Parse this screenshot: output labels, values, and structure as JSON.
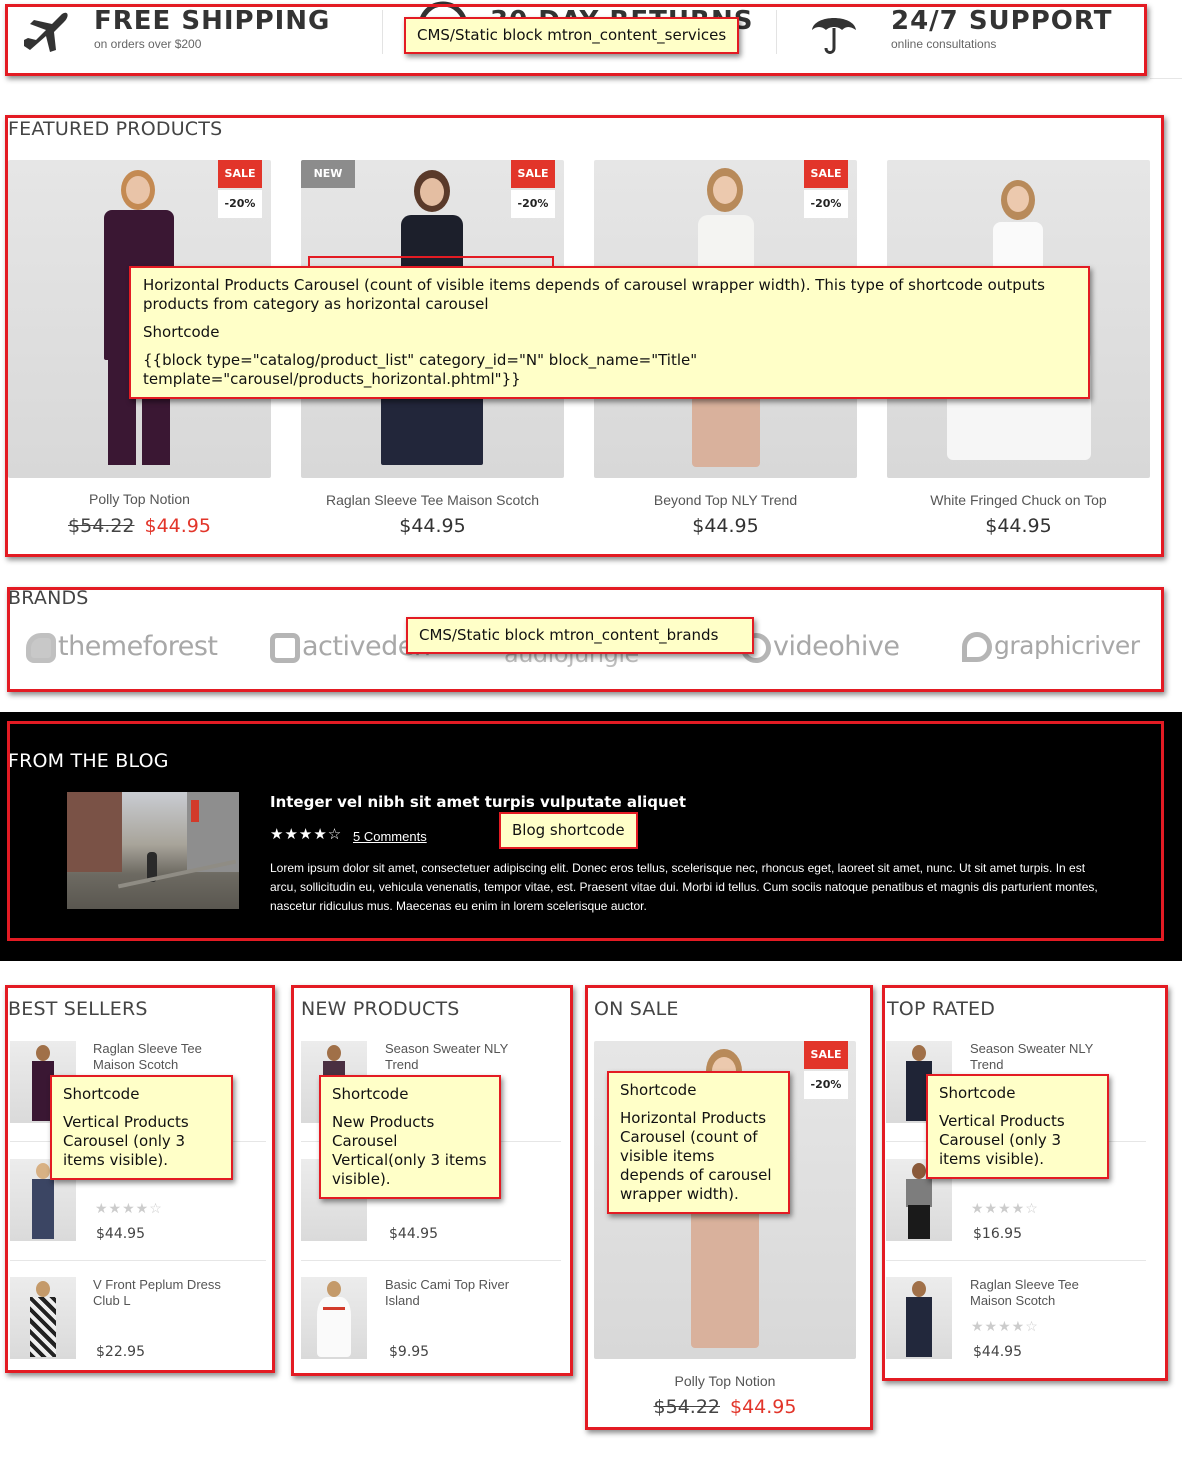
{
  "services": {
    "items": [
      {
        "title": "FREE SHIPPING",
        "subtitle": "on orders over $200",
        "icon": "airplane-icon"
      },
      {
        "title": "30 DAY RETURNS",
        "subtitle": "",
        "icon": "clock-icon"
      },
      {
        "title": "24/7 SUPPORT",
        "subtitle": "online consultations",
        "icon": "umbrella-icon"
      }
    ],
    "note": "CMS/Static block mtron_content_services"
  },
  "featured": {
    "title": "FEATURED PRODUCTS",
    "products": [
      {
        "name": "Polly Top Notion",
        "old_price": "$54.22",
        "price": "$44.95",
        "badge_sale": "SALE",
        "badge_pct": "-20%",
        "badge_new": ""
      },
      {
        "name": "Raglan Sleeve Tee Maison Scotch",
        "old_price": "",
        "price": "$44.95",
        "badge_sale": "SALE",
        "badge_pct": "-20%",
        "badge_new": "NEW"
      },
      {
        "name": "Beyond Top NLY Trend",
        "old_price": "",
        "price": "$44.95",
        "badge_sale": "SALE",
        "badge_pct": "-20%",
        "badge_new": ""
      },
      {
        "name": "White Fringed Chuck on Top",
        "old_price": "",
        "price": "$44.95",
        "badge_sale": "",
        "badge_pct": "",
        "badge_new": ""
      }
    ],
    "note": {
      "line1": "Horizontal Products Carousel (count of visible items depends of carousel wrapper width). This type of shortcode outputs products from category as horizontal carousel",
      "line2": "Shortcode",
      "line3": "{{block type=\"catalog/product_list\" category_id=\"N\" block_name=\"Title\" template=\"carousel/products_horizontal.phtml\"}}"
    }
  },
  "brands": {
    "title": "BRANDS",
    "items": [
      "themeforest",
      "activeden",
      "audiojungle",
      "videohive",
      "graphicriver"
    ],
    "note": "CMS/Static block mtron_content_brands"
  },
  "blog": {
    "title": "FROM THE BLOG",
    "post_title": "Integer vel nibh sit amet turpis vulputate aliquet",
    "stars": "★★★★☆",
    "comments": "5 Comments",
    "excerpt": "Lorem ipsum dolor sit amet, consectetuer adipiscing elit. Donec eros tellus, scelerisque nec, rhoncus eget, laoreet sit amet, nunc. Ut sit amet turpis. In est arcu, sollicitudin eu, vehicula venenatis, tempor vitae, est. Praesent vitae dui. Morbi id tellus. Cum sociis natoque penatibus et magnis dis parturient montes, nascetur ridiculus mus. Maecenas eu enim in lorem scelerisque auctor.",
    "note": "Blog shortcode"
  },
  "best_sellers": {
    "title": "BEST SELLERS",
    "items": [
      {
        "name": "Raglan Sleeve Tee Maison Scotch",
        "price": "",
        "stars": ""
      },
      {
        "name": "",
        "price": "$44.95",
        "stars": "★★★★☆"
      },
      {
        "name": "V Front Peplum Dress Club L",
        "price": "$22.95",
        "stars": ""
      }
    ],
    "note": {
      "line1": "Shortcode",
      "line2": "Vertical Products Carousel (only 3 items visible)."
    }
  },
  "new_products": {
    "title": "NEW PRODUCTS",
    "items": [
      {
        "name": "Season Sweater NLY Trend",
        "price": "",
        "stars": ""
      },
      {
        "name": "",
        "price": "$44.95",
        "stars": ""
      },
      {
        "name": "Basic Cami Top River Island",
        "price": "$9.95",
        "stars": ""
      }
    ],
    "note": {
      "line1": "Shortcode",
      "line2": "New Products Carousel Vertical(only 3 items visible)."
    }
  },
  "on_sale": {
    "title": "ON SALE",
    "product": {
      "name": "Polly Top Notion",
      "old_price": "$54.22",
      "price": "$44.95",
      "badge_sale": "SALE",
      "badge_pct": "-20%"
    },
    "note": {
      "line1": "Shortcode",
      "line2": "Horizontal Products Carousel (count of visible items depends of carousel wrapper width)."
    }
  },
  "top_rated": {
    "title": "TOP RATED",
    "items": [
      {
        "name": "Season Sweater NLY Trend",
        "price": "",
        "stars": ""
      },
      {
        "name": "",
        "price": "$16.95",
        "stars": "★★★★☆"
      },
      {
        "name": "Raglan Sleeve Tee Maison Scotch",
        "price": "$44.95",
        "stars": "★★★★☆"
      }
    ],
    "note": {
      "line1": "Shortcode",
      "line2": "Vertical Products Carousel (only 3 items visible)."
    }
  }
}
